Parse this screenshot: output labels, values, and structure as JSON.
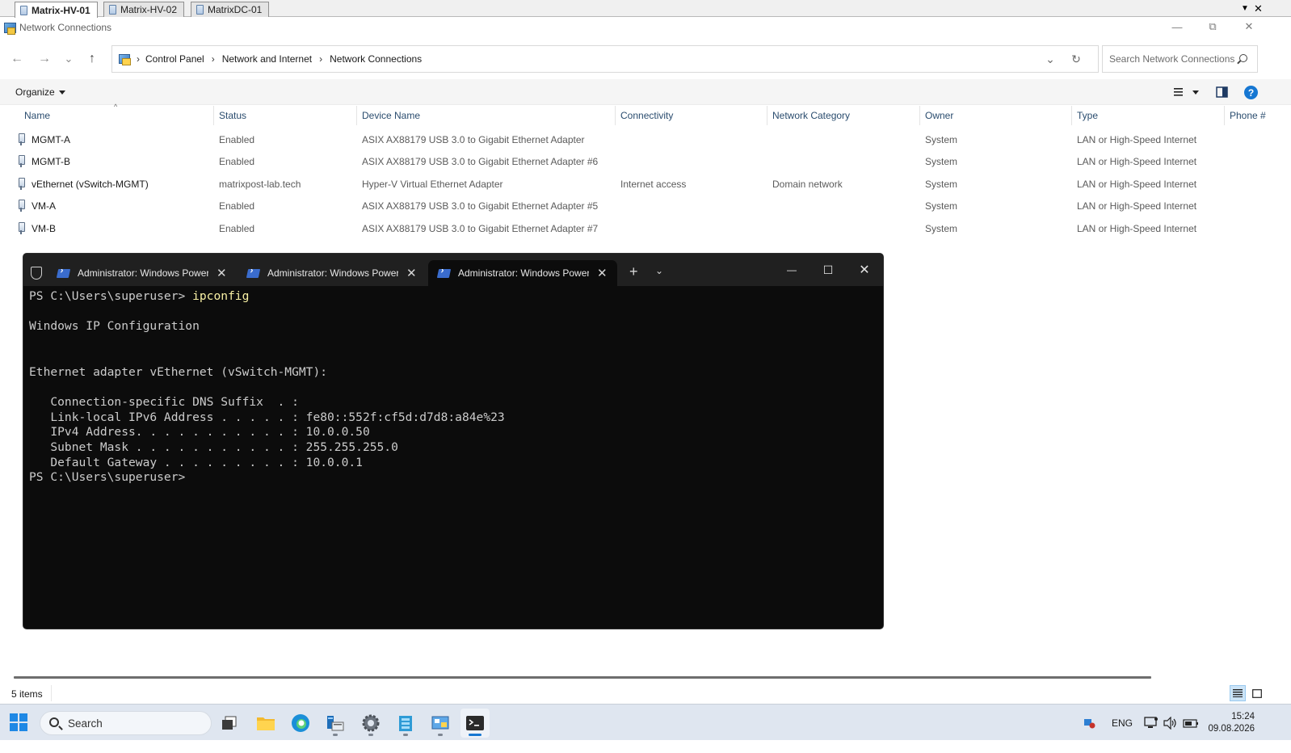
{
  "rdp": {
    "tabs": [
      {
        "label": "Matrix-HV-01",
        "active": true
      },
      {
        "label": "Matrix-HV-02",
        "active": false
      },
      {
        "label": "MatrixDC-01",
        "active": false
      }
    ],
    "dropdown_glyph": "▼",
    "close_glyph": "✕"
  },
  "window": {
    "title": "Network Connections",
    "minimize_glyph": "—",
    "restore_glyph": "⧉",
    "close_glyph": "✕"
  },
  "nav": {
    "back_glyph": "←",
    "forward_glyph": "→",
    "recent_glyph": "⌄",
    "up_glyph": "↑",
    "breadcrumb": [
      "Control Panel",
      "Network and Internet",
      "Network Connections"
    ],
    "crumb_sep": "›",
    "dropdown_glyph": "⌄",
    "refresh_glyph": "↻",
    "search_placeholder": "Search Network Connections"
  },
  "command_bar": {
    "organize_label": "Organize",
    "help_label": "?"
  },
  "columns": [
    "Name",
    "Status",
    "Device Name",
    "Connectivity",
    "Network Category",
    "Owner",
    "Type",
    "Phone #"
  ],
  "sort_glyph": "^",
  "rows": [
    {
      "name": "MGMT-A",
      "status": "Enabled",
      "device": "ASIX AX88179 USB 3.0 to Gigabit Ethernet Adapter",
      "connectivity": "",
      "category": "",
      "owner": "System",
      "type": "LAN or High-Speed Internet"
    },
    {
      "name": "MGMT-B",
      "status": "Enabled",
      "device": "ASIX AX88179 USB 3.0 to Gigabit Ethernet Adapter #6",
      "connectivity": "",
      "category": "",
      "owner": "System",
      "type": "LAN or High-Speed Internet"
    },
    {
      "name": "vEthernet (vSwitch-MGMT)",
      "status": "matrixpost-lab.tech",
      "device": "Hyper-V Virtual Ethernet Adapter",
      "connectivity": "Internet access",
      "category": "Domain network",
      "owner": "System",
      "type": "LAN or High-Speed Internet"
    },
    {
      "name": "VM-A",
      "status": "Enabled",
      "device": "ASIX AX88179 USB 3.0 to Gigabit Ethernet Adapter #5",
      "connectivity": "",
      "category": "",
      "owner": "System",
      "type": "LAN or High-Speed Internet"
    },
    {
      "name": "VM-B",
      "status": "Enabled",
      "device": "ASIX AX88179 USB 3.0 to Gigabit Ethernet Adapter #7",
      "connectivity": "",
      "category": "",
      "owner": "System",
      "type": "LAN or High-Speed Internet"
    }
  ],
  "terminal": {
    "tabs": [
      {
        "label": "Administrator: Windows PowerShell",
        "active": false
      },
      {
        "label": "Administrator: Windows PowerShell",
        "active": false
      },
      {
        "label": "Administrator: Windows PowerShell",
        "active": true
      }
    ],
    "tab_close_glyph": "✕",
    "new_tab_glyph": "+",
    "dropdown_glyph": "⌄",
    "minimize_glyph": "—",
    "maximize_glyph": "☐",
    "close_glyph": "✕",
    "prompt": "PS C:\\Users\\superuser> ",
    "command": "ipconfig",
    "output": "\nWindows IP Configuration\n\n\nEthernet adapter vEthernet (vSwitch-MGMT):\n\n   Connection-specific DNS Suffix  . :\n   Link-local IPv6 Address . . . . . : fe80::552f:cf5d:d7d8:a84e%23\n   IPv4 Address. . . . . . . . . . . : 10.0.0.50\n   Subnet Mask . . . . . . . . . . . : 255.255.255.0\n   Default Gateway . . . . . . . . . : 10.0.0.1\nPS C:\\Users\\superuser>"
  },
  "status_bar": {
    "item_count": "5 items"
  },
  "taskbar": {
    "search_label": "Search",
    "tray_language": "ENG",
    "time": "15:24",
    "date": "09.08.2026"
  }
}
